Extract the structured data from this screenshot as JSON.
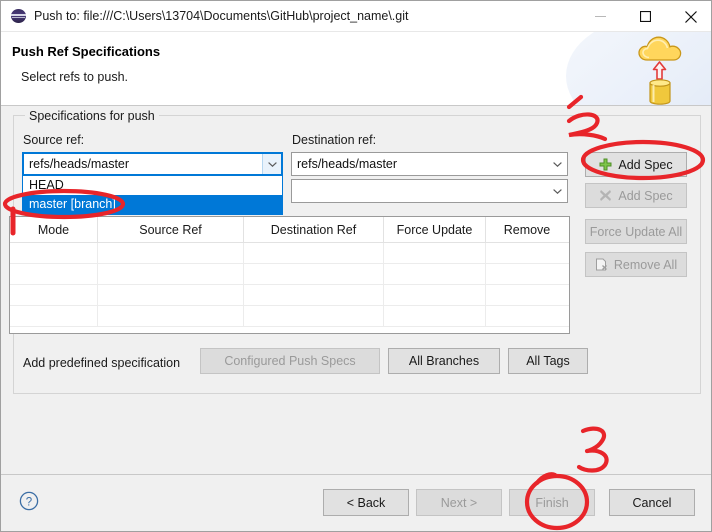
{
  "window": {
    "title": "Push to: file:///C:\\Users\\13704\\Documents\\GitHub\\project_name\\.git",
    "icon": "eclipse-git-icon",
    "minimize_label": "minimize-icon",
    "maximize_label": "maximize-icon",
    "close_label": "close-icon"
  },
  "header": {
    "title": "Push Ref Specifications",
    "subtitle": "Select refs to push.",
    "banner_icon": "push-to-cloud-icon"
  },
  "group": {
    "label": "Specifications for push",
    "source_ref_label": "Source ref:",
    "destination_ref_label": "Destination ref:",
    "source_ref_value": "refs/heads/master",
    "destination_ref_value": "refs/heads/master",
    "source_ref_row2_value": "",
    "destination_ref_row2_value": "",
    "source_dropdown_open": true,
    "source_dropdown_options": [
      {
        "label": "HEAD",
        "selected": false
      },
      {
        "label": "master [branch]",
        "selected": true
      }
    ],
    "buttons": {
      "add_spec": "Add Spec",
      "add_spec_secondary": "Add Spec",
      "force_update_all": "Force Update All",
      "remove_all": "Remove All"
    },
    "table": {
      "columns": [
        "Mode",
        "Source Ref",
        "Destination Ref",
        "Force Update",
        "Remove"
      ],
      "rows": []
    },
    "predefined_label": "Add predefined specification",
    "predefined_buttons": {
      "configured_push_specs": "Configured Push Specs",
      "all_branches": "All Branches",
      "all_tags": "All Tags"
    }
  },
  "footer": {
    "help": "?",
    "back": "< Back",
    "next": "Next >",
    "finish": "Finish",
    "cancel": "Cancel"
  },
  "annotations": {
    "mark_1": "",
    "mark_2": "2",
    "mark_3": "3",
    "color": "#e8252a"
  }
}
